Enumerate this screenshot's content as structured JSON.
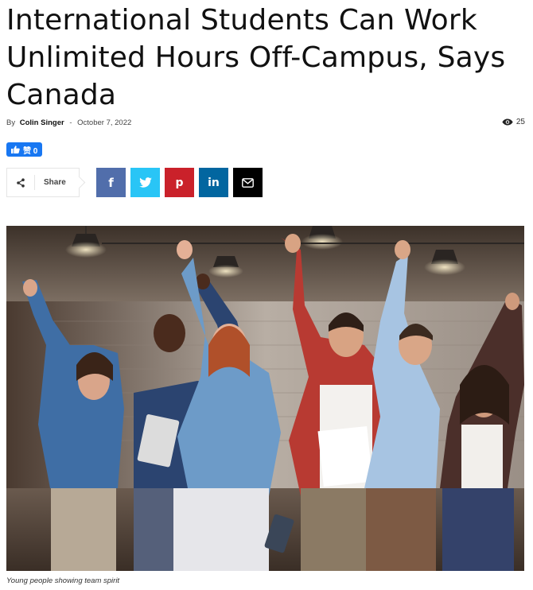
{
  "article": {
    "title": "International Students Can Work Unlimited Hours Off-Campus, Says Canada",
    "by_label": "By",
    "author": "Colin Singer",
    "separator": "-",
    "date": "October 7, 2022",
    "views": "25"
  },
  "like_button": {
    "label": "赞 0"
  },
  "share": {
    "label": "Share",
    "networks": [
      {
        "name": "facebook",
        "color": "#516eab",
        "icon": "facebook-icon"
      },
      {
        "name": "twitter",
        "color": "#29c5f6",
        "icon": "twitter-icon"
      },
      {
        "name": "pinterest",
        "color": "#ca212a",
        "icon": "pinterest-icon"
      },
      {
        "name": "linkedin",
        "color": "#0266a0",
        "icon": "linkedin-icon"
      },
      {
        "name": "email",
        "color": "#000000",
        "icon": "email-icon"
      }
    ]
  },
  "image": {
    "caption": "Young people showing team spirit"
  }
}
